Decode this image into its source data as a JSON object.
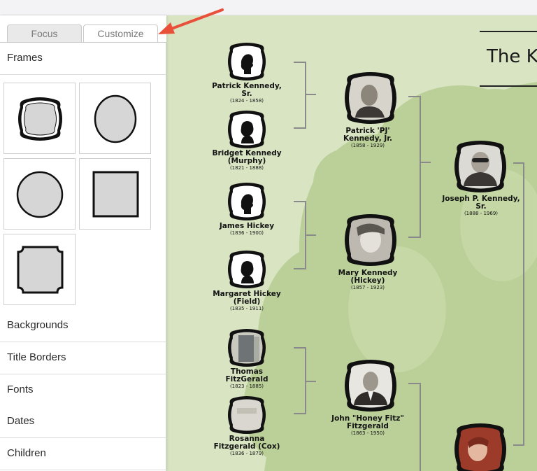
{
  "tabs": {
    "focus": "Focus",
    "customize": "Customize"
  },
  "panel": {
    "frames_label": "Frames",
    "sections": [
      "Backgrounds",
      "Title Borders",
      "Fonts",
      "Dates",
      "Children"
    ]
  },
  "chart": {
    "title": "The Ke",
    "people": [
      {
        "name": "Patrick Kennedy, Sr.",
        "dates": "(1824 - 1858)"
      },
      {
        "name": "Bridget Kennedy (Murphy)",
        "dates": "(1821 - 1888)"
      },
      {
        "name": "James Hickey",
        "dates": "(1836 - 1900)"
      },
      {
        "name": "Margaret Hickey (Field)",
        "dates": "(1835 - 1911)"
      },
      {
        "name": "Thomas FitzGerald",
        "dates": "(1823 - 1885)"
      },
      {
        "name": "Rosanna Fitzgerald (Cox)",
        "dates": "(1836 - 1879)"
      },
      {
        "name": "Patrick 'PJ' Kennedy, Jr.",
        "dates": "(1858 - 1929)"
      },
      {
        "name": "Mary Kennedy (Hickey)",
        "dates": "(1857 - 1923)"
      },
      {
        "name": "John \"Honey Fitz\" Fitzgerald",
        "dates": "(1863 - 1950)"
      },
      {
        "name": "Joseph P. Kennedy, Sr.",
        "dates": "(1888 - 1969)"
      }
    ]
  },
  "colors": {
    "canvas_bg": "#d8e4c2",
    "tree": "#b6cc92",
    "arrow": "#e8503a",
    "connector": "#8a8a8a"
  }
}
